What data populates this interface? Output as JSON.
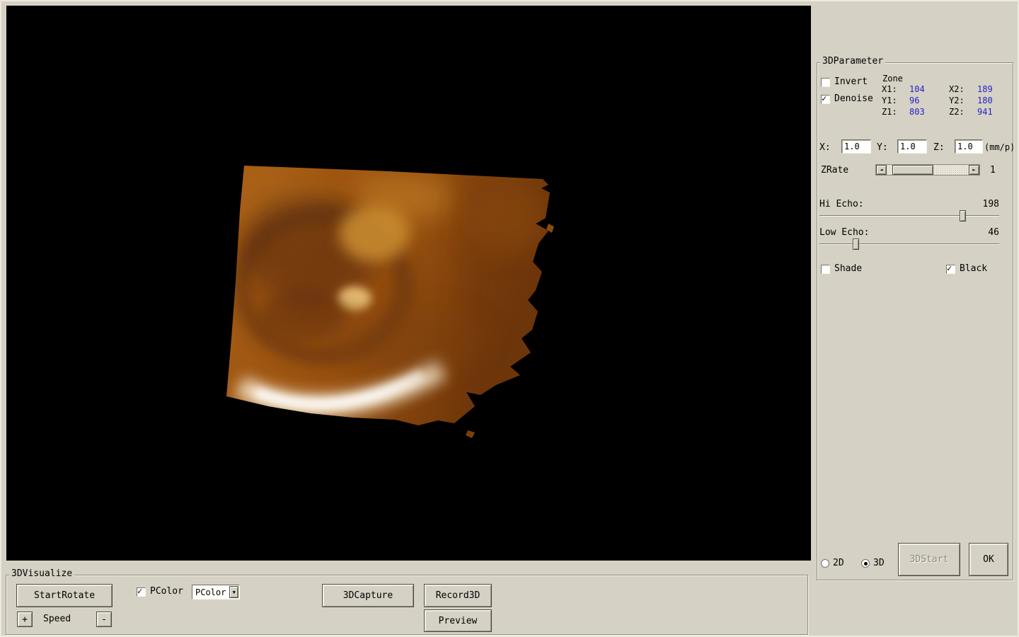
{
  "icons": {
    "check": "✓",
    "arrow_left": "◄",
    "arrow_right": "►",
    "dropdown": "▼"
  },
  "colors": {
    "value_blue": "#2222cc",
    "panel": "#d5d1c4",
    "viewport": "#000000"
  },
  "states": {
    "invert": false,
    "denoise": true,
    "pcolor": true,
    "shade": false,
    "black": true,
    "r2d": false,
    "r3d": true
  },
  "param": {
    "title": "3DParameter",
    "invert": "Invert",
    "denoise": "Denoise",
    "zone_title": "Zone",
    "zone": {
      "x1l": "X1:",
      "x1": "104",
      "x2l": "X2:",
      "x2": "189",
      "y1l": "Y1:",
      "y1": "96",
      "y2l": "Y2:",
      "y2": "180",
      "z1l": "Z1:",
      "z1": "803",
      "z2l": "Z2:",
      "z2": "941"
    },
    "xl": "X:",
    "xv": "1.0",
    "yl": "Y:",
    "yv": "1.0",
    "zl": "Z:",
    "zv": "1.0",
    "unit": "(mm/p)",
    "zrate": "ZRate",
    "zrate_value": "1",
    "hi": "Hi Echo:",
    "hi_value": "198",
    "low": "Low Echo:",
    "low_value": "46",
    "shade": "Shade",
    "black": "Black",
    "r2d": "2D",
    "r3d": "3D",
    "start": "3DStart",
    "ok": "OK"
  },
  "visualize": {
    "title": "3DVisualize",
    "start_rotate": "StartRotate",
    "pcolor": "PColor",
    "pcolor_selected": "PColor",
    "capture": "3DCapture",
    "record": "Record3D",
    "preview": "Preview",
    "plus": "+",
    "speed": "Speed",
    "minus": "-"
  }
}
